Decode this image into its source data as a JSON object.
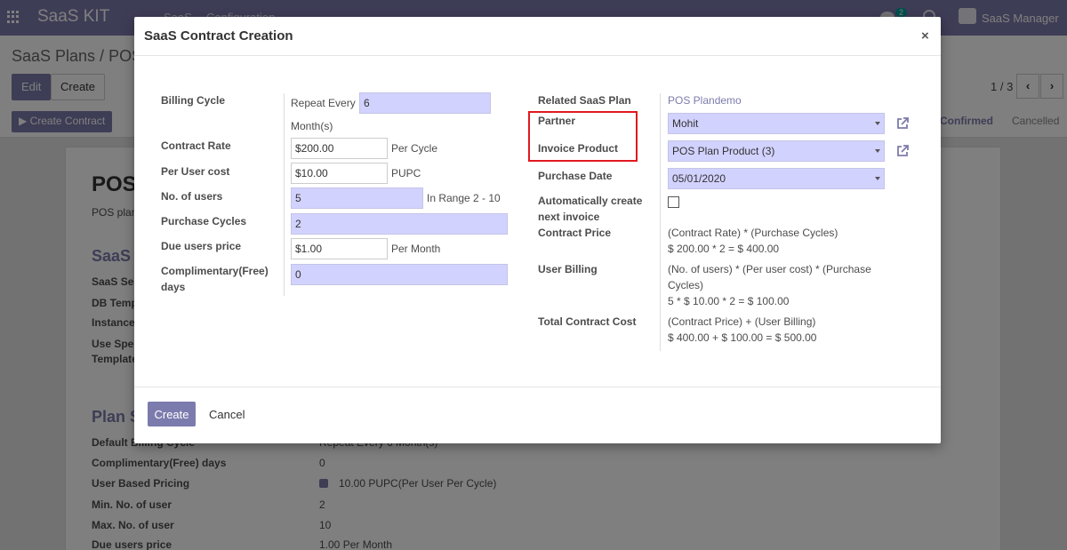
{
  "app": {
    "brand": "SaaS KIT",
    "menu": [
      "SaaS",
      "Configuration"
    ],
    "chat_badge": "2",
    "user": "SaaS Manager"
  },
  "background": {
    "breadcrumb": "SaaS Plans / POS",
    "edit_label": "Edit",
    "create_label": "Create",
    "pager": "1 / 3",
    "create_contract_label": "Create Contract",
    "statuses": [
      "Confirmed",
      "Cancelled"
    ],
    "record_title": "POS",
    "record_subtitle": "POS plan",
    "section_saas": "SaaS",
    "saas_fields": [
      "SaaS Se",
      "DB Temp",
      "Instance",
      "Use Spec",
      "Template"
    ],
    "section_plan": "Plan S",
    "plan_fields": [
      {
        "label": "Default Billing Cycle",
        "value": "Repeat Every 6 Month(s)"
      },
      {
        "label": "Complimentary(Free) days",
        "value": "0"
      },
      {
        "label": "User Based Pricing",
        "value": "10.00 PUPC(Per User Per Cycle)"
      },
      {
        "label": "Min. No. of user",
        "value": "2"
      },
      {
        "label": "Max. No. of user",
        "value": "10"
      },
      {
        "label": "Due users price",
        "value": "1.00 Per Month"
      }
    ]
  },
  "modal": {
    "title": "SaaS Contract Creation",
    "close": "×",
    "create_label": "Create",
    "cancel_label": "Cancel",
    "left": {
      "billing_cycle_label": "Billing Cycle",
      "repeat_every_text": "Repeat Every",
      "repeat_every_value": "6",
      "months_text": "Month(s)",
      "contract_rate_label": "Contract Rate",
      "contract_rate_value": "$200.00",
      "contract_rate_suffix": "Per Cycle",
      "per_user_cost_label": "Per User cost",
      "per_user_cost_value": "$10.00",
      "per_user_cost_suffix": "PUPC",
      "no_users_label": "No. of users",
      "no_users_value": "5",
      "no_users_suffix": "In Range 2 - 10",
      "purchase_cycles_label": "Purchase Cycles",
      "purchase_cycles_value": "2",
      "due_users_price_label": "Due users price",
      "due_users_price_value": "$1.00",
      "due_users_price_suffix": "Per Month",
      "complimentary_label_1": "Complimentary(Free)",
      "complimentary_label_2": "days",
      "complimentary_value": "0"
    },
    "right": {
      "related_plan_label": "Related SaaS Plan",
      "related_plan_value": "POS Plandemo",
      "partner_label": "Partner",
      "partner_value": "Mohit",
      "invoice_product_label": "Invoice Product",
      "invoice_product_value": "POS Plan Product (3)",
      "purchase_date_label": "Purchase Date",
      "purchase_date_value": "05/01/2020",
      "auto_invoice_label_1": "Automatically create",
      "auto_invoice_label_2": "next invoice",
      "contract_price_label": "Contract Price",
      "contract_price_formula": "(Contract Rate) * (Purchase Cycles)",
      "contract_price_result": "$ 200.00 * 2 = $ 400.00",
      "user_billing_label": "User Billing",
      "user_billing_formula_1": "(No. of users) * (Per user cost) * (Purchase",
      "user_billing_formula_2": "Cycles)",
      "user_billing_result": "5 * $ 10.00 * 2 = $ 100.00",
      "total_cost_label": "Total Contract Cost",
      "total_cost_formula": "(Contract Price) + (User Billing)",
      "total_cost_result": "$ 400.00 + $ 100.00 = $ 500.00"
    }
  }
}
